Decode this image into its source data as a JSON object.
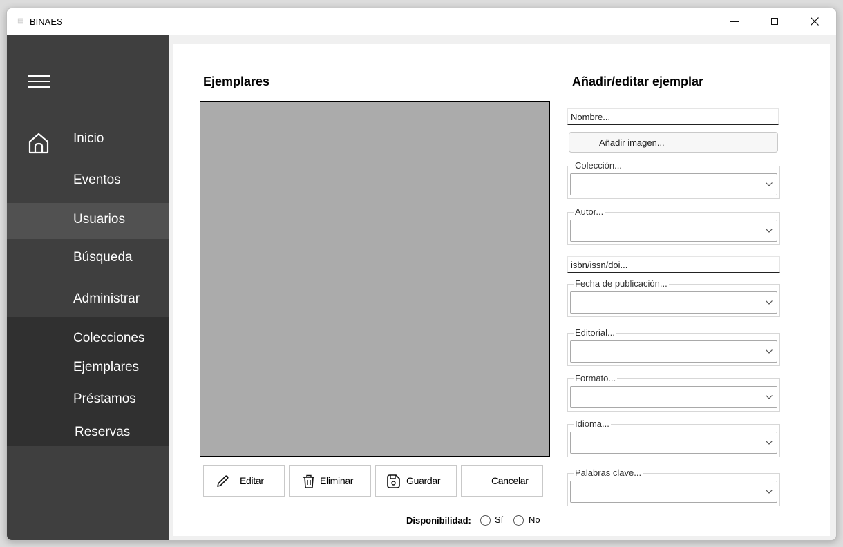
{
  "window": {
    "title": "BINAES",
    "icon": "app-icon",
    "controls": [
      "minimize-icon",
      "maximize-icon",
      "close-icon"
    ]
  },
  "sidebar": {
    "menu_icon": "hamburger-icon",
    "home_icon": "home-icon",
    "items": [
      {
        "label": "Inicio",
        "active": false
      },
      {
        "label": "Eventos",
        "active": false
      },
      {
        "label": "Usuarios",
        "active": true
      },
      {
        "label": "Búsqueda",
        "active": false
      },
      {
        "label": "Administrar",
        "active": false
      }
    ],
    "submenu": [
      {
        "label": "Colecciones"
      },
      {
        "label": "Ejemplares"
      },
      {
        "label": "Préstamos"
      },
      {
        "label": "Reservas"
      }
    ]
  },
  "main": {
    "title": "Ejemplares",
    "actions": [
      {
        "label": "Editar",
        "icon": "pencil-icon"
      },
      {
        "label": "Eliminar",
        "icon": "trash-icon"
      },
      {
        "label": "Guardar",
        "icon": "save-icon"
      },
      {
        "label": "Cancelar",
        "icon": ""
      }
    ],
    "availability": {
      "label": "Disponibilidad:",
      "options": [
        "Sí",
        "No"
      ]
    }
  },
  "form": {
    "title": "Añadir/editar ejemplar",
    "name_placeholder": "Nombre...",
    "image_button": "Añadir imagen...",
    "isbn_placeholder": "isbn/issn/doi...",
    "groups": [
      {
        "label": "Colección...",
        "value": ""
      },
      {
        "label": "Autor...",
        "value": ""
      },
      {
        "label": "Fecha de publicación...",
        "value": ""
      },
      {
        "label": "Editorial...",
        "value": ""
      },
      {
        "label": "Formato...",
        "value": ""
      },
      {
        "label": "Idioma...",
        "value": ""
      },
      {
        "label": "Palabras clave...",
        "value": ""
      }
    ]
  },
  "colors": {
    "sidebar": "#3f3f3f",
    "sidebar_active": "#515151",
    "submenu": "#303030",
    "image_placeholder": "#ababab"
  }
}
